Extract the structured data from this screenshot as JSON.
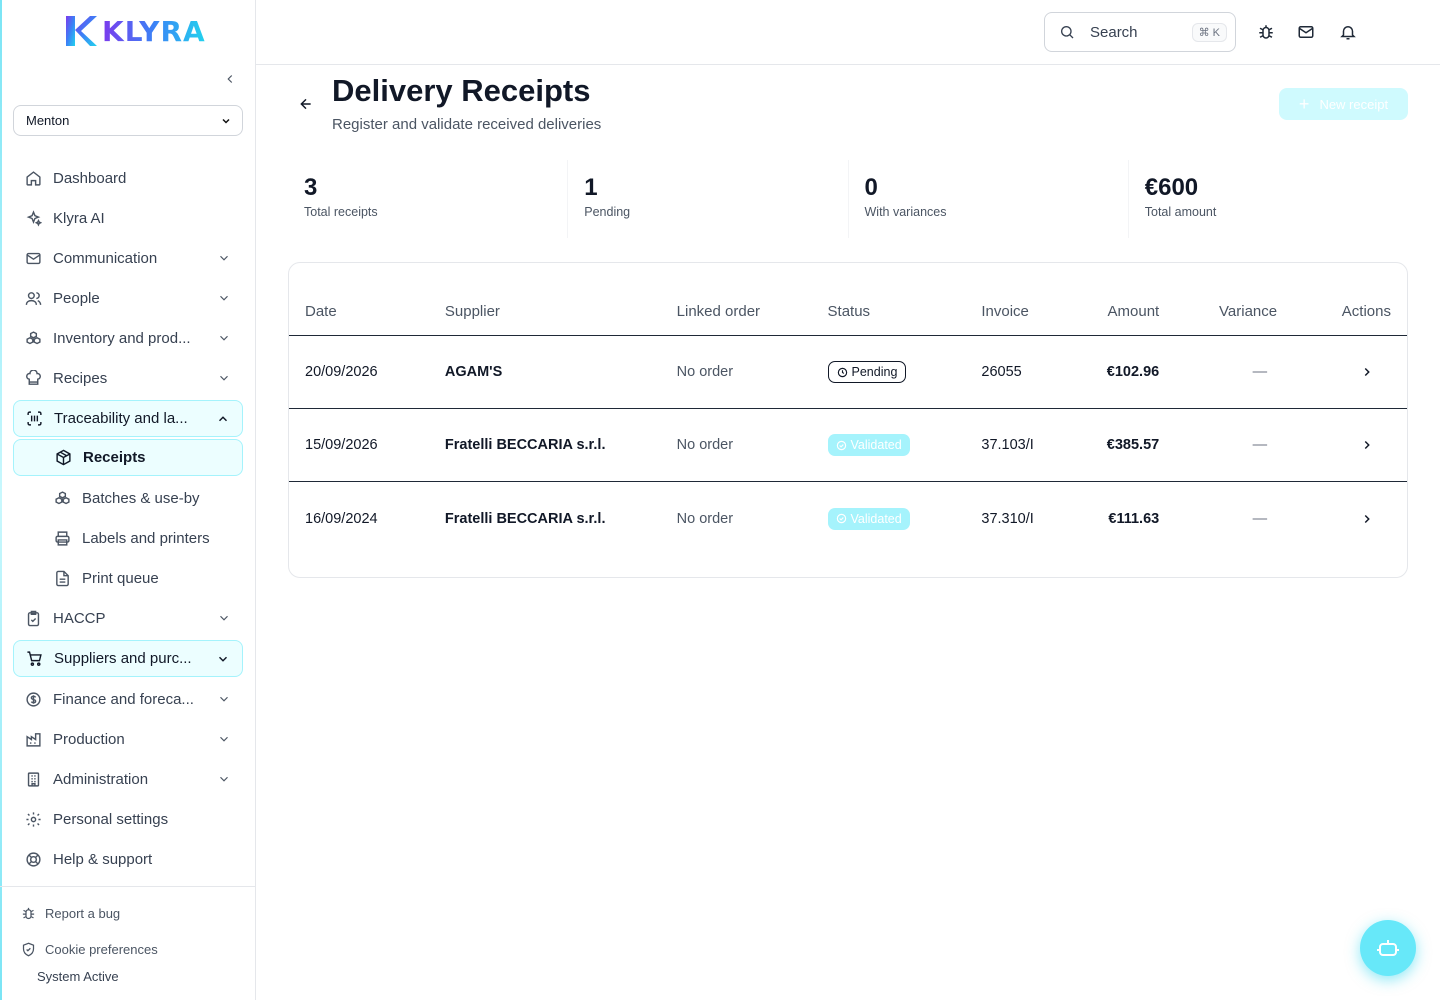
{
  "brand": {
    "name": "KLYRA"
  },
  "sidebar": {
    "site": "Menton",
    "items": [
      {
        "label": "Dashboard"
      },
      {
        "label": "Klyra AI"
      },
      {
        "label": "Communication"
      },
      {
        "label": "People"
      },
      {
        "label": "Inventory and prod..."
      },
      {
        "label": "Recipes"
      },
      {
        "label": "Traceability and la..."
      },
      {
        "label": "Receipts"
      },
      {
        "label": "Batches & use-by"
      },
      {
        "label": "Labels and printers"
      },
      {
        "label": "Print queue"
      },
      {
        "label": "HACCP"
      },
      {
        "label": "Suppliers and purc..."
      },
      {
        "label": "Finance and foreca..."
      },
      {
        "label": "Production"
      },
      {
        "label": "Administration"
      },
      {
        "label": "Personal settings"
      },
      {
        "label": "Help & support"
      }
    ],
    "footer": {
      "report_bug": "Report a bug",
      "cookies": "Cookie preferences",
      "status": "System Active"
    }
  },
  "topbar": {
    "search_label": "Search",
    "search_shortcut": "⌘ K"
  },
  "page": {
    "title": "Delivery Receipts",
    "subtitle": "Register and validate received deliveries",
    "new_button": "New receipt"
  },
  "stats": [
    {
      "value": "3",
      "caption": "Total receipts"
    },
    {
      "value": "1",
      "caption": "Pending"
    },
    {
      "value": "0",
      "caption": "With variances"
    },
    {
      "value": "€600",
      "caption": "Total amount"
    }
  ],
  "table": {
    "headers": [
      "Date",
      "Supplier",
      "Linked order",
      "Status",
      "Invoice",
      "Amount",
      "Variance",
      "Actions"
    ],
    "rows": [
      {
        "date": "20/09/2026",
        "supplier": "AGAM'S",
        "order": "No order",
        "status": "Pending",
        "invoice": "26055",
        "amount": "€102.96",
        "variance": "—"
      },
      {
        "date": "15/09/2026",
        "supplier": "Fratelli BECCARIA s.r.l.",
        "order": "No order",
        "status": "Validated",
        "invoice": "37.103/I",
        "amount": "€385.57",
        "variance": "—"
      },
      {
        "date": "16/09/2024",
        "supplier": "Fratelli BECCARIA s.r.l.",
        "order": "No order",
        "status": "Validated",
        "invoice": "37.310/I",
        "amount": "€111.63",
        "variance": "—"
      }
    ]
  },
  "colors": {
    "accent": "#22d3ee",
    "accent_light": "#ecfeff",
    "border_active": "#a5f3fc"
  }
}
